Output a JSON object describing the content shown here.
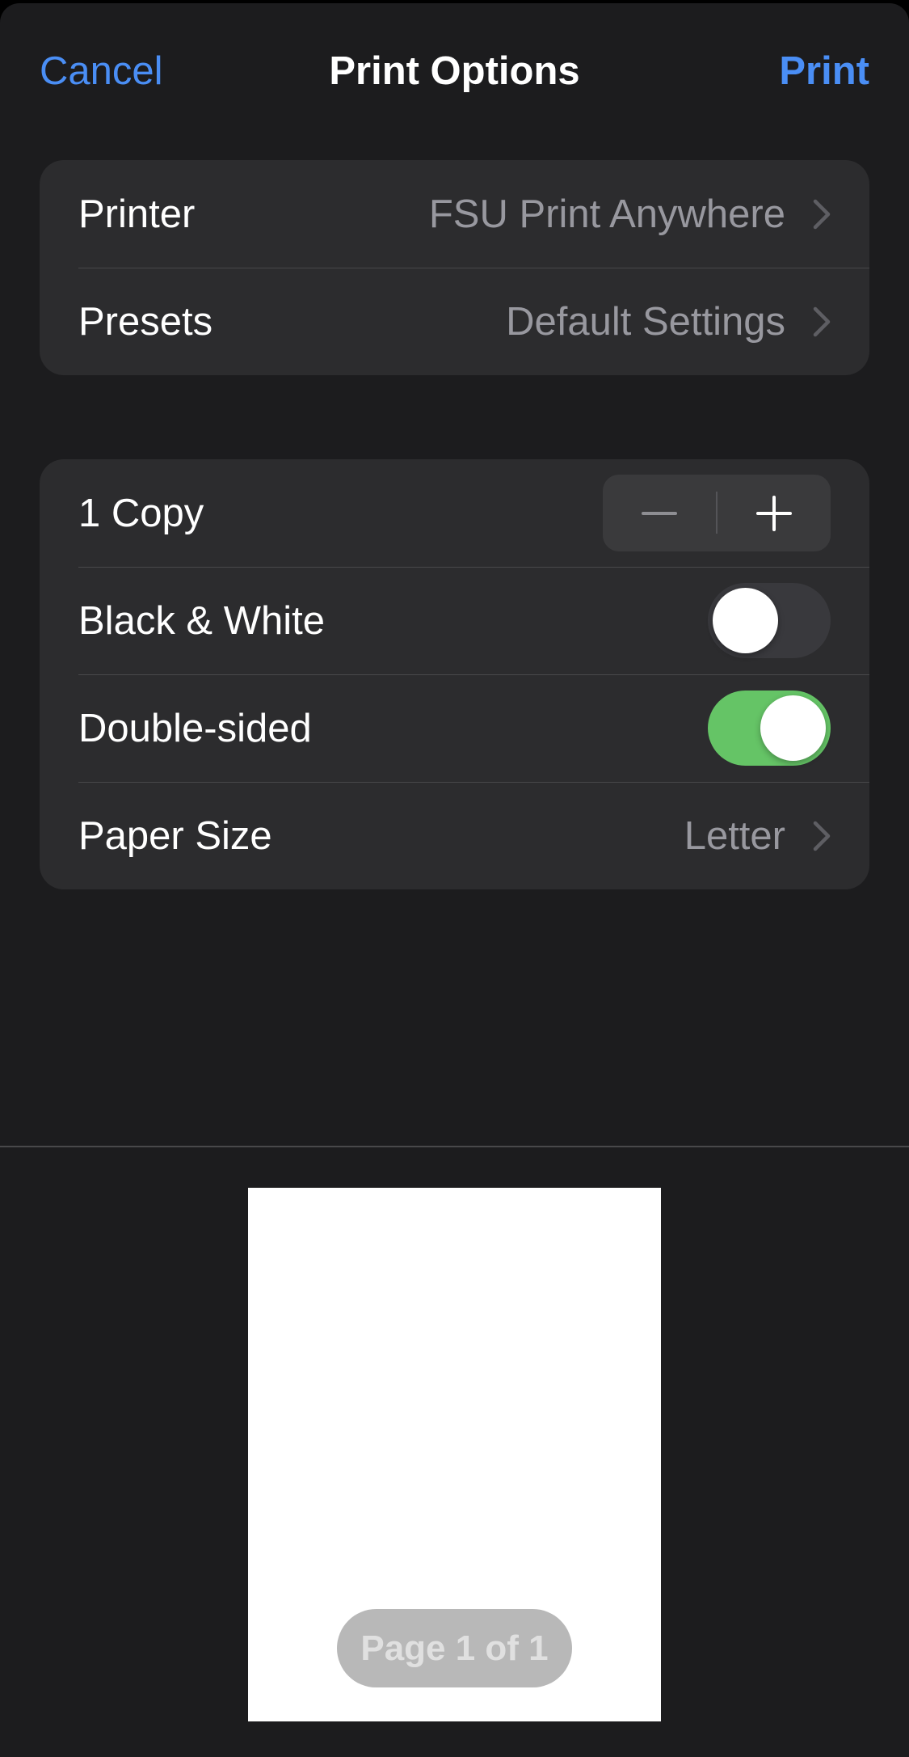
{
  "navbar": {
    "cancel_label": "Cancel",
    "title": "Print Options",
    "print_label": "Print"
  },
  "printer_group": {
    "printer": {
      "label": "Printer",
      "value": "FSU Print Anywhere"
    },
    "presets": {
      "label": "Presets",
      "value": "Default Settings"
    }
  },
  "options_group": {
    "copies": {
      "label": "1 Copy",
      "count": 1
    },
    "black_white": {
      "label": "Black & White",
      "enabled": false
    },
    "double_sided": {
      "label": "Double-sided",
      "enabled": true
    },
    "paper_size": {
      "label": "Paper Size",
      "value": "Letter"
    }
  },
  "preview": {
    "page_indicator": "Page 1 of 1"
  },
  "colors": {
    "accent": "#4a8ef5",
    "toggle_on": "#65c466",
    "background": "#1c1c1e",
    "group_background": "#2c2c2e"
  },
  "icons": {
    "chevron": "chevron-right-icon",
    "minus": "minus-icon",
    "plus": "plus-icon"
  }
}
